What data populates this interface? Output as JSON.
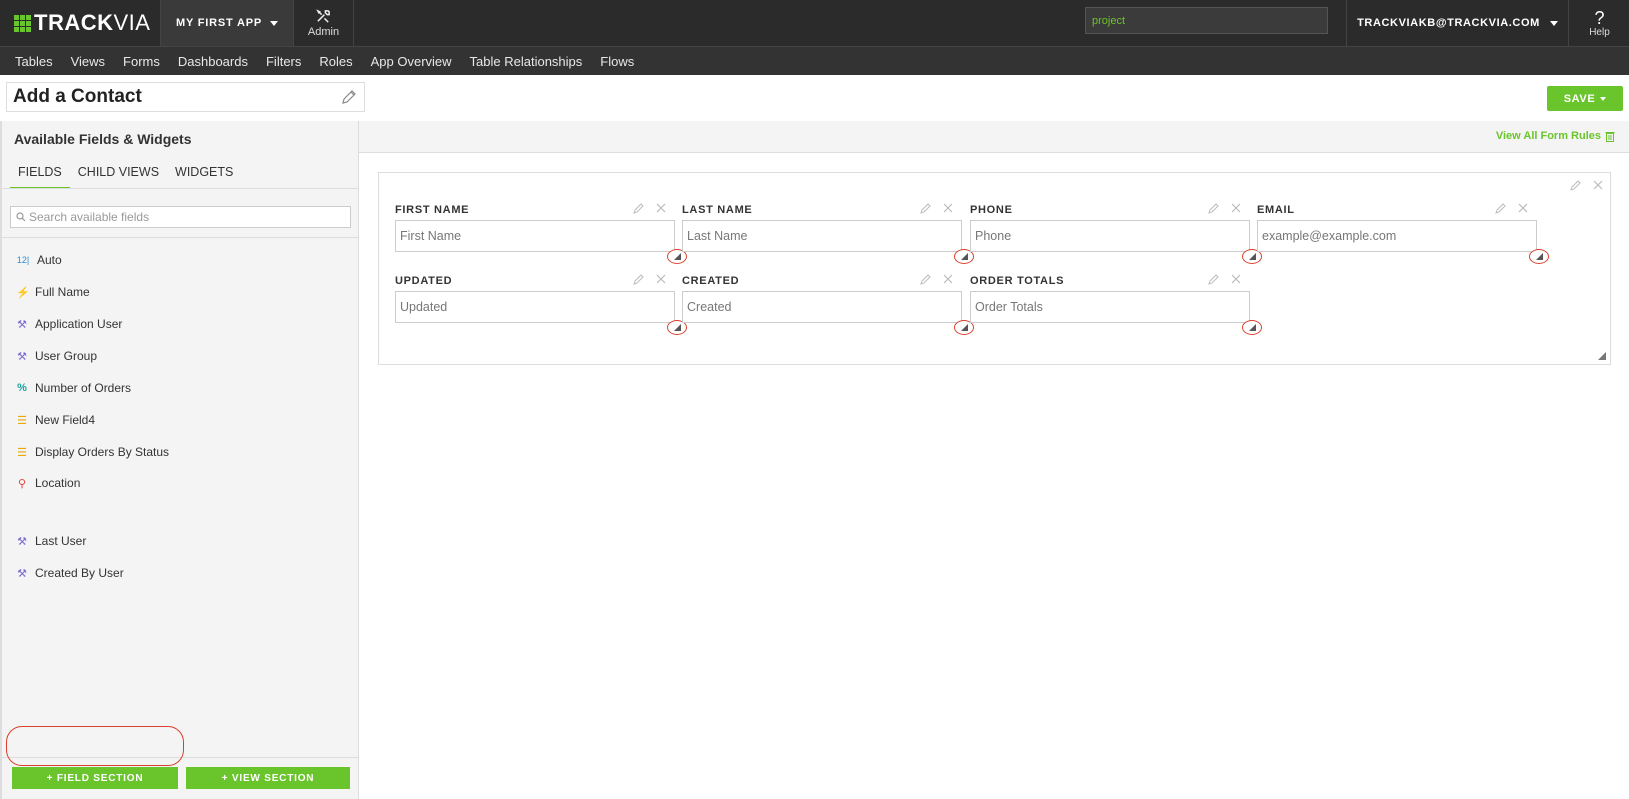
{
  "header": {
    "logo_bold": "TRACK",
    "logo_light": "VIA",
    "app_name": "MY FIRST APP",
    "admin_label": "Admin",
    "search_value": "project",
    "user_email": "TRACKVIAKB@TRACKVIA.COM",
    "help_label": "Help"
  },
  "menu": {
    "items": [
      "Tables",
      "Views",
      "Forms",
      "Dashboards",
      "Filters",
      "Roles",
      "App Overview",
      "Table Relationships",
      "Flows"
    ]
  },
  "form": {
    "title": "Add a Contact",
    "save_label": "SAVE"
  },
  "sidebar": {
    "heading": "Available Fields & Widgets",
    "tabs": [
      "FIELDS",
      "CHILD VIEWS",
      "WIDGETS"
    ],
    "active_tab": "FIELDS",
    "search_placeholder": "Search available fields",
    "fields": [
      {
        "label": "Auto",
        "icon": "auto-number-icon",
        "icon_glyph": "12|"
      },
      {
        "label": "Full Name",
        "icon": "lightning-icon",
        "icon_glyph": "⚡"
      },
      {
        "label": "Application User",
        "icon": "user-wand-icon",
        "icon_glyph": "⚒"
      },
      {
        "label": "User Group",
        "icon": "user-wand-icon",
        "icon_glyph": "⚒"
      },
      {
        "label": "Number of Orders",
        "icon": "percent-icon",
        "icon_glyph": "%"
      },
      {
        "label": "New Field4",
        "icon": "list-icon",
        "icon_glyph": "☰"
      },
      {
        "label": "Display Orders By Status",
        "icon": "list-icon",
        "icon_glyph": "☰"
      },
      {
        "label": "Location",
        "icon": "map-pin-icon",
        "icon_glyph": "⚲"
      },
      {
        "label": "Last User",
        "icon": "user-wand-icon",
        "icon_glyph": "⚒"
      },
      {
        "label": "Created By User",
        "icon": "user-wand-icon",
        "icon_glyph": "⚒"
      }
    ],
    "field_section_button": "+ FIELD SECTION",
    "view_section_button": "+ VIEW SECTION"
  },
  "canvas": {
    "rules_link": "View All Form Rules",
    "fields": [
      {
        "label": "FIRST NAME",
        "placeholder": "First Name"
      },
      {
        "label": "LAST NAME",
        "placeholder": "Last Name"
      },
      {
        "label": "PHONE",
        "placeholder": "Phone"
      },
      {
        "label": "EMAIL",
        "placeholder": "example@example.com"
      },
      {
        "label": "UPDATED",
        "placeholder": "Updated"
      },
      {
        "label": "CREATED",
        "placeholder": "Created"
      },
      {
        "label": "ORDER TOTALS",
        "placeholder": "Order Totals"
      }
    ]
  },
  "colors": {
    "brand_green": "#6ac42b",
    "topbar_bg": "#2b2b2b",
    "annotation_red": "#d9402b"
  }
}
